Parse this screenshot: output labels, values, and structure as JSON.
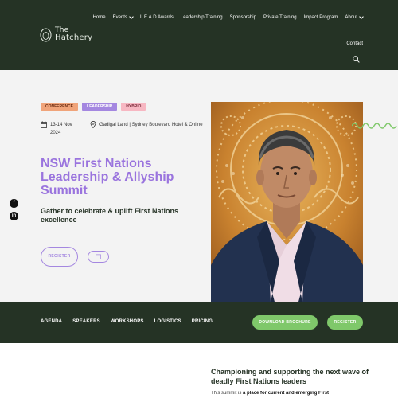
{
  "header": {
    "logo": {
      "line1": "The",
      "line2": "Hatchery"
    },
    "nav": [
      {
        "label": "Home",
        "dropdown": false
      },
      {
        "label": "Events",
        "dropdown": true
      },
      {
        "label": "L.E.A.D Awards",
        "dropdown": false
      },
      {
        "label": "Leadership Training",
        "dropdown": false
      },
      {
        "label": "Sponsorship",
        "dropdown": false
      },
      {
        "label": "Private Training",
        "dropdown": false
      },
      {
        "label": "Impact Program",
        "dropdown": false
      },
      {
        "label": "About",
        "dropdown": true
      }
    ],
    "contact": "Contact",
    "search_icon": "search-icon"
  },
  "hero": {
    "tags": [
      "CONFERENCE",
      "LEADERSHIP",
      "HYBRID"
    ],
    "date": "13-14 Nov 2024",
    "location": "Gadigal Land | Sydney Boulevard Hotel & Online",
    "title": "NSW First Nations Leadership & Allyship Summit",
    "subtitle": "Gather to celebrate & uplift First Nations excellence",
    "register_label": "REGISTER",
    "calendar_icon": "calendar-icon"
  },
  "social": [
    "f",
    "in"
  ],
  "band": {
    "links": [
      "AGENDA",
      "SPEAKERS",
      "WORKSHOPS",
      "LOGISTICS",
      "PRICING"
    ],
    "brochure_label": "DOWNLOAD BROCHURE",
    "register_label": "REGISTER"
  },
  "section": {
    "title": "Championing and supporting the next wave of deadly First Nations leaders",
    "text_prefix": "This summit is ",
    "text_bold": "a place for current and emerging First"
  },
  "colors": {
    "dark_green": "#253325",
    "purple": "#9a74de",
    "green_button": "#7fc86a",
    "orange_tag": "#f0a47a",
    "pink_tag": "#f7b7c2"
  }
}
